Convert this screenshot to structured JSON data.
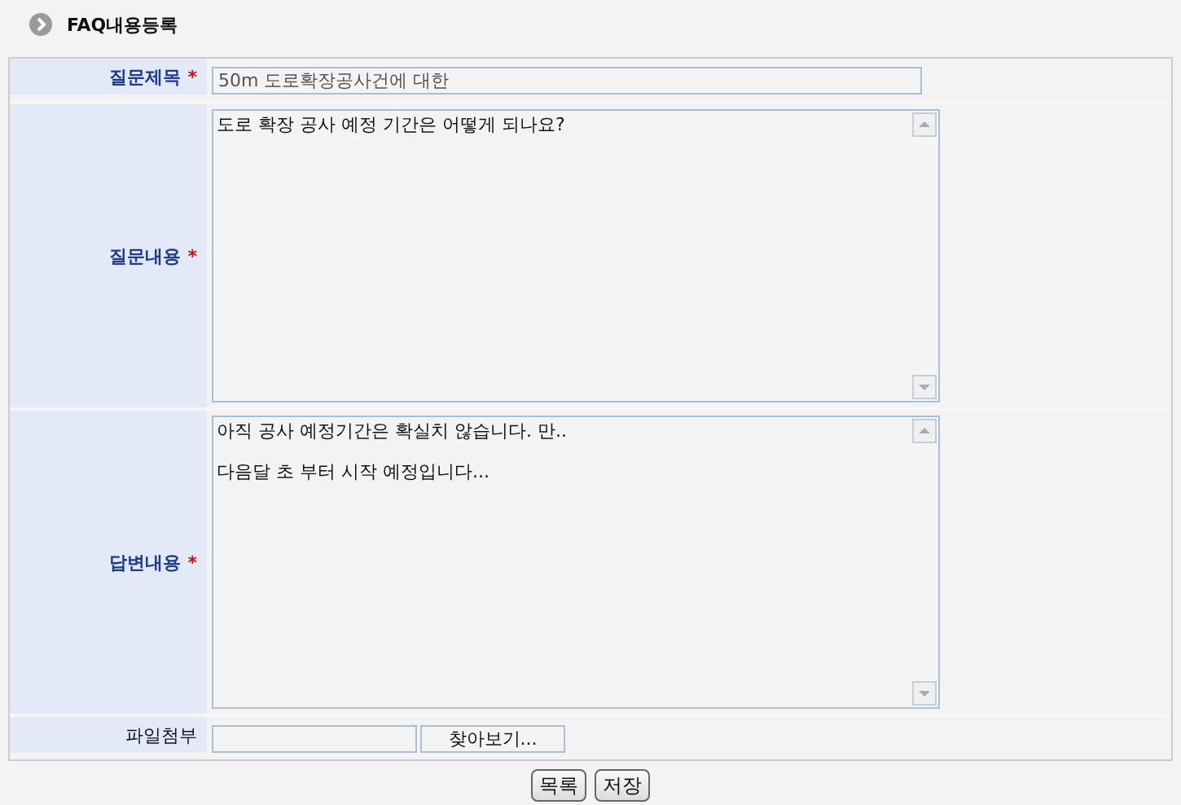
{
  "page_title": "FAQ내용등록",
  "rows": [
    {
      "kind": "text",
      "label": "질문제목",
      "required_mark": "*",
      "value": "50m 도로확장공사건에 대한"
    },
    {
      "kind": "textarea",
      "label": "질문내용",
      "required_mark": "*",
      "value": "도로 확장 공사 예정 기간은 어떻게 되나요?"
    },
    {
      "kind": "textarea",
      "label": "답변내용",
      "required_mark": "*",
      "value": "아직 공사 예정기간은 확실치 않습니다. 만..\n\n다음달 초 부터 시작 예정입니다..."
    },
    {
      "kind": "file",
      "label": "파일첨부",
      "browse": "찾아보기..."
    }
  ],
  "buttons": [
    "목록",
    "저장"
  ]
}
